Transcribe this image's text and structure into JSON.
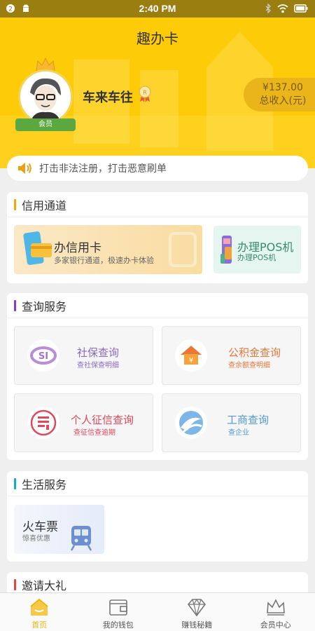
{
  "status_bar": {
    "time": "2:40 PM"
  },
  "header": {
    "title": "趣办卡",
    "member_badge": "会员",
    "username": "车来车往",
    "income_amount": "¥137.00",
    "income_label": "总收入(元)"
  },
  "notice": {
    "text": "打击非法注册，打击恶意刷单"
  },
  "credit": {
    "title": "信用通道",
    "card_title": "办信用卡",
    "card_sub": "多家银行通道，极速办卡体验",
    "pos_title": "办理POS机",
    "pos_sub": "办理POS机"
  },
  "query": {
    "title": "查询服务",
    "items": [
      {
        "title": "社保查询",
        "sub": "查社保查明细",
        "color": "#8a68c8"
      },
      {
        "title": "公积金查询",
        "sub": "查余额查明细",
        "color": "#e8773c"
      },
      {
        "title": "个人征信查询",
        "sub": "查征信查逾期",
        "color": "#e0485a"
      },
      {
        "title": "工商查询",
        "sub": "查企业",
        "color": "#4f9ad8"
      }
    ]
  },
  "life": {
    "title": "生活服务",
    "train_title": "火车票",
    "train_sub": "惊喜优惠"
  },
  "invite": {
    "title": "邀请大礼"
  },
  "tabs": [
    {
      "label": "首页"
    },
    {
      "label": "我的钱包"
    },
    {
      "label": "赚钱秘籍"
    },
    {
      "label": "会员中心"
    }
  ],
  "colors": {
    "brand_yellow": "#fdcb07",
    "status_bar": "#9a7f10",
    "credit_accent": "#f2a60c",
    "query_accent": "#8a3bc8",
    "life_accent": "#18a8c8",
    "invite_accent": "#e8443a"
  },
  "icons": [
    "speaker-icon",
    "credit-card-icon",
    "pos-machine-icon",
    "social-security-icon",
    "housing-fund-icon",
    "credit-report-icon",
    "business-icon",
    "train-icon",
    "home-icon",
    "wallet-icon",
    "diamond-icon",
    "crown-icon"
  ]
}
